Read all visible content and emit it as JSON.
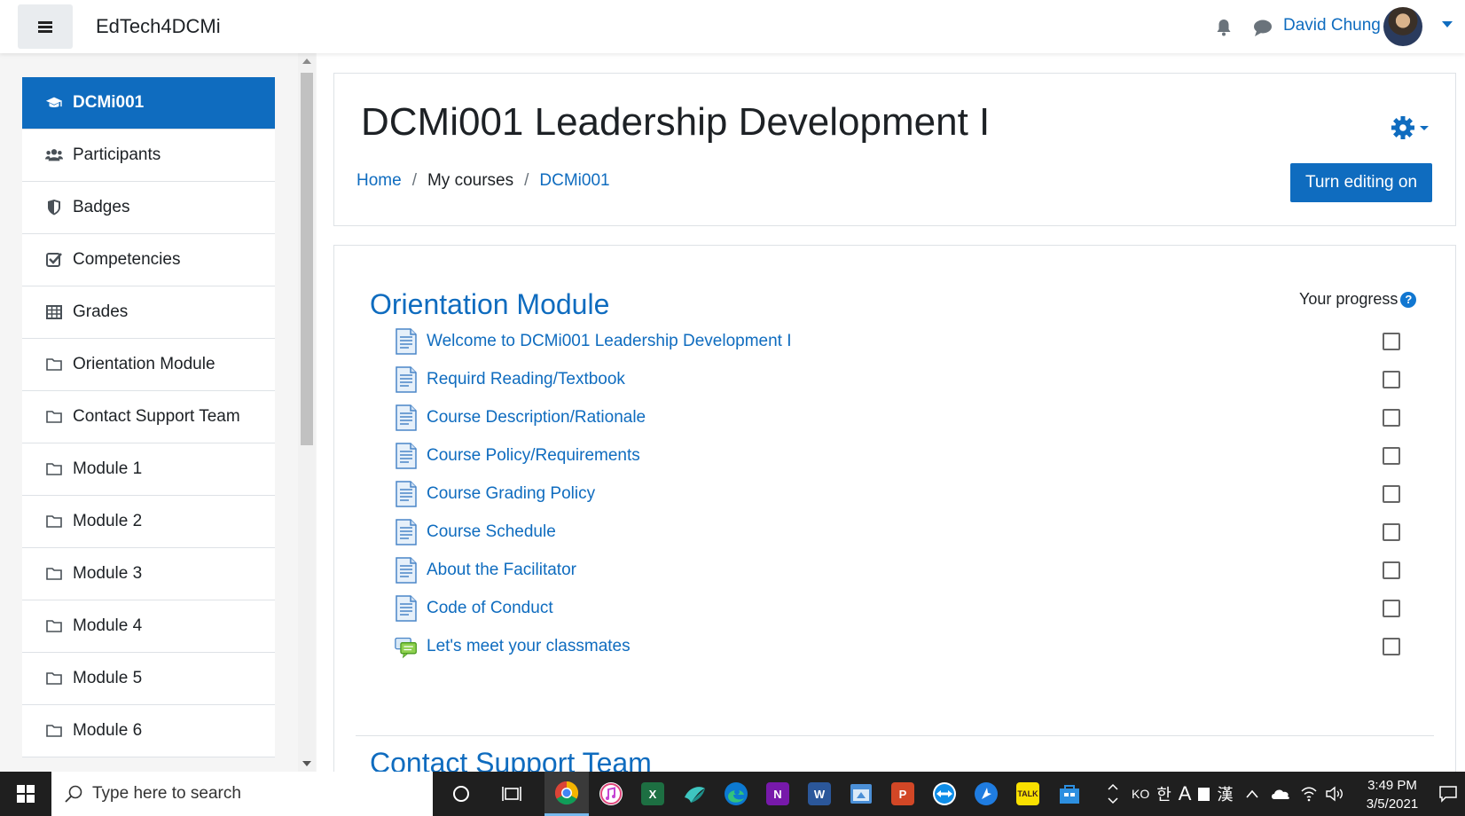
{
  "navbar": {
    "brand": "EdTech4DCMi",
    "user_name": "David Chung"
  },
  "drawer": {
    "items": [
      {
        "label": "DCMi001",
        "icon": "graduation-cap-icon",
        "active": true
      },
      {
        "label": "Participants",
        "icon": "users-icon"
      },
      {
        "label": "Badges",
        "icon": "shield-icon"
      },
      {
        "label": "Competencies",
        "icon": "check-square-icon"
      },
      {
        "label": "Grades",
        "icon": "table-icon"
      },
      {
        "label": "Orientation Module",
        "icon": "folder-icon"
      },
      {
        "label": "Contact Support Team",
        "icon": "folder-icon"
      },
      {
        "label": "Module 1",
        "icon": "folder-icon"
      },
      {
        "label": "Module 2",
        "icon": "folder-icon"
      },
      {
        "label": "Module 3",
        "icon": "folder-icon"
      },
      {
        "label": "Module 4",
        "icon": "folder-icon"
      },
      {
        "label": "Module 5",
        "icon": "folder-icon"
      },
      {
        "label": "Module 6",
        "icon": "folder-icon"
      }
    ]
  },
  "header": {
    "course_title": "DCMi001 Leadership Development I",
    "breadcrumb": [
      "Home",
      "My courses",
      "DCMi001"
    ],
    "edit_button": "Turn editing on"
  },
  "section": {
    "title": "Orientation Module",
    "progress_label": "Your progress",
    "help_icon": "?",
    "activities": [
      {
        "label": "Welcome to DCMi001 Leadership Development I",
        "icon": "page-icon",
        "completed": false
      },
      {
        "label": "Requird Reading/Textbook",
        "icon": "page-icon",
        "completed": false
      },
      {
        "label": "Course Description/Rationale",
        "icon": "page-icon",
        "completed": false
      },
      {
        "label": "Course Policy/Requirements",
        "icon": "page-icon",
        "completed": false
      },
      {
        "label": "Course Grading Policy",
        "icon": "page-icon",
        "completed": false
      },
      {
        "label": "Course Schedule",
        "icon": "page-icon",
        "completed": false
      },
      {
        "label": "About the Facilitator",
        "icon": "page-icon",
        "completed": false
      },
      {
        "label": "Code of Conduct",
        "icon": "page-icon",
        "completed": false
      },
      {
        "label": "Let's meet your classmates",
        "icon": "forum-icon",
        "completed": false
      }
    ],
    "next_section_title": "Contact Support Team"
  },
  "taskbar": {
    "search_placeholder": "Type here to search",
    "apps": [
      "Chrome",
      "iTunes",
      "Excel",
      "Edge",
      "OneNote",
      "Word",
      "PowerPoint",
      "TeamViewer",
      "KakaoTalk"
    ],
    "tray": {
      "lang": "KO",
      "ime": "한",
      "ime2": "A",
      "hanja": "漢"
    },
    "time": "3:49 PM",
    "date": "3/5/2021"
  }
}
